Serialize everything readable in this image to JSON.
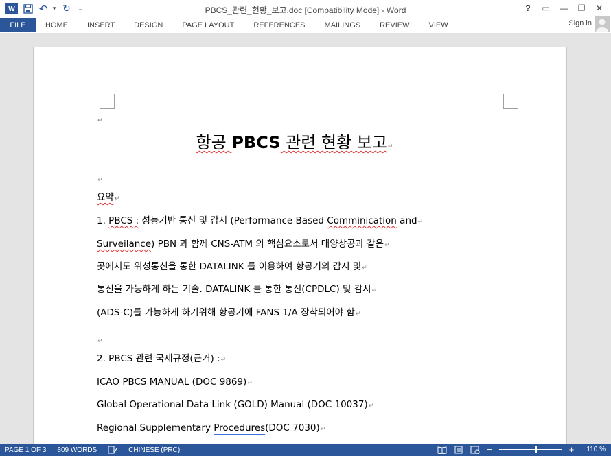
{
  "window": {
    "title": "PBCS_관련_현황_보고.doc [Compatibility Mode] - Word",
    "help": "?",
    "minimize": "—",
    "restore": "❐",
    "close": "✕",
    "ribbon_display": "▭"
  },
  "qat": {
    "app_logo": "W",
    "save_icon": "save-icon",
    "undo": "↶",
    "undo_dropdown": "▾",
    "redo": "↻",
    "customize": "₌"
  },
  "ribbon": {
    "file": "FILE",
    "tabs": [
      "HOME",
      "INSERT",
      "DESIGN",
      "PAGE LAYOUT",
      "REFERENCES",
      "MAILINGS",
      "REVIEW",
      "VIEW"
    ],
    "sign_in": "Sign in"
  },
  "document": {
    "title_pre": "항공 ",
    "title_bold": "PBCS",
    "title_post": " 관련 현황 보고",
    "pilcrow": "↵",
    "summary_heading": "요약",
    "p1_l1_a": "1. ",
    "p1_l1_b": "PBCS :",
    "p1_l1_c": " 성능기반 통신 및 감시 (Performance Based ",
    "p1_l1_d": "Comminication",
    "p1_l1_e": " and",
    "p1_l2_a": "Surveilance",
    "p1_l2_b": ") PBN 과 함께 CNS-ATM 의 핵심요소로서 대양상공과 같은",
    "p1_l3": "곳에서도 위성통신을 통한 DATALINK 를 이용하여 항공기의 감시 및",
    "p1_l4": "통신을 가능하게 하는 기술. DATALINK 를 통한 통신(CPDLC) 및 감시",
    "p1_l5": "(ADS-C)를 가능하게 하기위해 항공기에 FANS 1/A 장착되어야 함",
    "p2_heading": "2. PBCS 관련 국제규정(근거) :",
    "ref1": "ICAO PBCS MANUAL (DOC 9869)",
    "ref2": "Global Operational Data Link (GOLD) Manual (DOC 10037)",
    "ref3_a": "Regional Supplementary ",
    "ref3_b": "Procedures",
    "ref3_c": "(DOC 7030)"
  },
  "status": {
    "page": "PAGE 1 OF 3",
    "words": "809 WORDS",
    "language": "CHINESE (PRC)",
    "zoom_minus": "−",
    "zoom_plus": "+",
    "zoom": "110 %"
  },
  "colors": {
    "accent": "#2b579a",
    "spell_error": "#e03030"
  }
}
